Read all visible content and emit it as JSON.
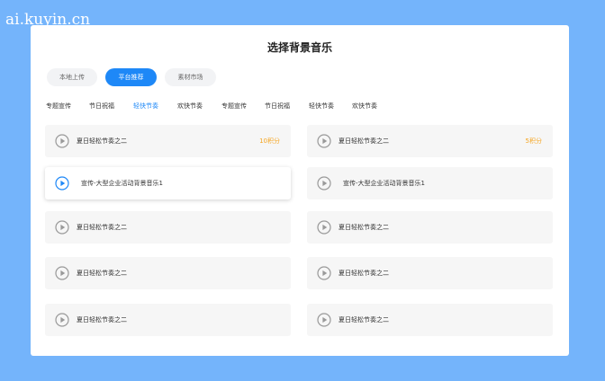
{
  "watermark": "ai.kuyin.cn",
  "dialog": {
    "title": "选择背景音乐"
  },
  "source_tabs": [
    {
      "label": "本地上传",
      "active": false
    },
    {
      "label": "平台推荐",
      "active": true
    },
    {
      "label": "素材市场",
      "active": false
    }
  ],
  "categories": [
    {
      "label": "专题宣传",
      "active": false
    },
    {
      "label": "节日祝福",
      "active": false
    },
    {
      "label": "轻快节奏",
      "active": true
    },
    {
      "label": "欢快节奏",
      "active": false
    },
    {
      "label": "专题宣传",
      "active": false
    },
    {
      "label": "节日祝福",
      "active": false
    },
    {
      "label": "轻快节奏",
      "active": false
    },
    {
      "label": "欢快节奏",
      "active": false
    }
  ],
  "colors": {
    "background": "#74b4fb",
    "accent": "#1e88f7",
    "price": "#f5a623"
  },
  "icons": {
    "play": "play-circle-icon"
  },
  "music_items": [
    {
      "title": "夏日轻松节奏之二",
      "price": "10积分",
      "selected": false
    },
    {
      "title": "夏日轻松节奏之二",
      "price": "5积分",
      "selected": false
    },
    {
      "title": "宣传-大型企业活动背景音乐1",
      "price": "",
      "selected": true
    },
    {
      "title": "宣传-大型企业活动背景音乐1",
      "price": "",
      "selected": false
    },
    {
      "title": "夏日轻松节奏之二",
      "price": "",
      "selected": false
    },
    {
      "title": "夏日轻松节奏之二",
      "price": "",
      "selected": false
    },
    {
      "title": "夏日轻松节奏之二",
      "price": "",
      "selected": false
    },
    {
      "title": "夏日轻松节奏之二",
      "price": "",
      "selected": false
    },
    {
      "title": "夏日轻松节奏之二",
      "price": "",
      "selected": false
    },
    {
      "title": "夏日轻松节奏之二",
      "price": "",
      "selected": false
    }
  ]
}
